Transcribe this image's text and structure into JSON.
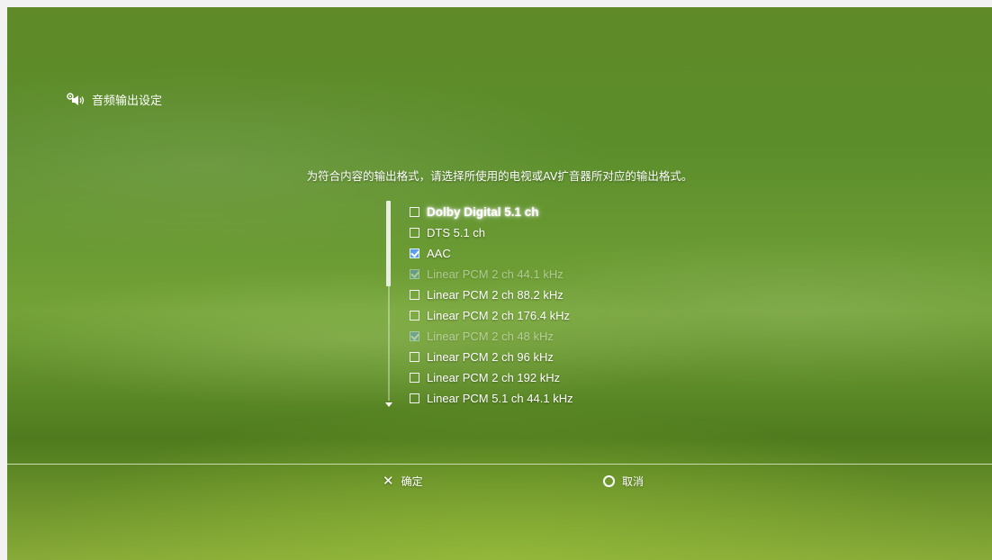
{
  "header": {
    "title": "音频输出设定",
    "icon": "speaker-settings-icon"
  },
  "instruction": "为符合内容的输出格式，请选择所使用的电视或AV扩音器所对应的输出格式。",
  "options": [
    {
      "label": "Dolby Digital 5.1 ch",
      "checked": false,
      "focused": true,
      "disabled": false
    },
    {
      "label": "DTS 5.1 ch",
      "checked": false,
      "focused": false,
      "disabled": false
    },
    {
      "label": "AAC",
      "checked": true,
      "focused": false,
      "disabled": false
    },
    {
      "label": "Linear PCM 2 ch 44.1 kHz",
      "checked": true,
      "focused": false,
      "disabled": true
    },
    {
      "label": "Linear PCM 2 ch 88.2 kHz",
      "checked": false,
      "focused": false,
      "disabled": false
    },
    {
      "label": "Linear PCM 2 ch 176.4 kHz",
      "checked": false,
      "focused": false,
      "disabled": false
    },
    {
      "label": "Linear PCM 2 ch 48 kHz",
      "checked": true,
      "focused": false,
      "disabled": true
    },
    {
      "label": "Linear PCM 2 ch 96 kHz",
      "checked": false,
      "focused": false,
      "disabled": false
    },
    {
      "label": "Linear PCM 2 ch 192 kHz",
      "checked": false,
      "focused": false,
      "disabled": false
    },
    {
      "label": "Linear PCM 5.1 ch 44.1 kHz",
      "checked": false,
      "focused": false,
      "disabled": false
    }
  ],
  "footer": {
    "confirm": {
      "glyph": "✕",
      "label": "确定",
      "icon": "cross-button-icon"
    },
    "cancel": {
      "glyph": "",
      "label": "取消",
      "icon": "circle-button-icon"
    }
  },
  "colors": {
    "background": "#6a962c",
    "checkbox_checked": "#5aa0e8",
    "text": "#ffffff"
  }
}
